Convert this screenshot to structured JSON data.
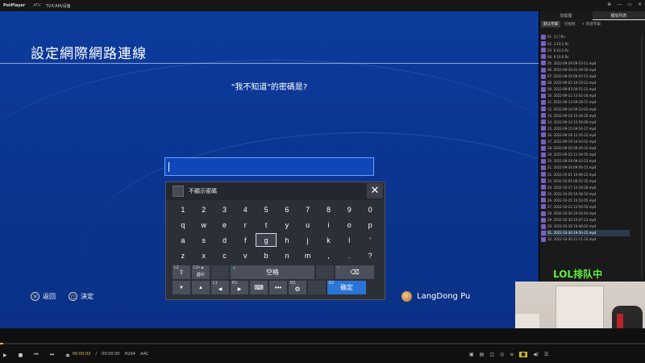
{
  "titlebar": {
    "app": "PotPlayer",
    "crumbs": [
      "ATV",
      "TV/CAM/设备"
    ],
    "window_buttons": [
      "pin",
      "minimize",
      "restore",
      "close"
    ]
  },
  "ps_screen": {
    "title": "設定網際網路連線",
    "question": "\"我不知道\"的密碼是?",
    "keyboard": {
      "hide_password_label": "不顯示密碼",
      "close_label": "✕",
      "rows": [
        [
          "1",
          "2",
          "3",
          "4",
          "5",
          "6",
          "7",
          "8",
          "9",
          "0"
        ],
        [
          "q",
          "w",
          "e",
          "r",
          "t",
          "y",
          "u",
          "i",
          "o",
          "p"
        ],
        [
          "a",
          "s",
          "d",
          "f",
          "g",
          "h",
          "j",
          "k",
          "l",
          "'"
        ],
        [
          "z",
          "x",
          "c",
          "v",
          "b",
          "n",
          "m",
          ",",
          ".",
          "?"
        ]
      ],
      "selected_key": "g",
      "func_row1": {
        "l2_tag": "L2",
        "l2up_tag": "L2+▲",
        "l2up_label": "@#:",
        "tri_tag": "▲",
        "space_label": "空格",
        "square_tag": "□",
        "backspace_label": "⌫"
      },
      "func_row2": {
        "down": "▼",
        "up": "▲",
        "l1_tag": "L1",
        "left": "◀",
        "r1_tag": "R1",
        "right": "▶",
        "keyboard_icon": "⌨",
        "more_label": "•••",
        "r3_tag": "R3",
        "r2_tag": "R2",
        "confirm_label": "确定"
      }
    },
    "footer": {
      "back_symbol": "✕",
      "back_label": "返回",
      "ok_symbol": "○",
      "ok_label": "決定"
    },
    "user": "LangDong Pu"
  },
  "player": {
    "time_current": "00:00:03",
    "time_total": "00:00:00",
    "codec1": "H264",
    "codec2": "AAC",
    "progress_fraction": 0.005,
    "accent": "#e0b83a"
  },
  "panel": {
    "tabs": [
      "加载器",
      "播放列表"
    ],
    "active_tab": 1,
    "subtabs": [
      "默认专辑",
      "近视频",
      "+ 新建专辑"
    ],
    "items": [
      "01. 大门.flv",
      "02. 3.10.1.flv",
      "03. 9.10.2.flv",
      "04. 9.10.6.flv",
      "05. 2022-09-29 09-53-11.mp4",
      "06. 2022-09-30 01-49-50.mp4",
      "07. 2022-09-30 09-47-11.mp4",
      "08. 2022-09-02 10-19-12.mp4",
      "09. 2022-09-03 09-51-21.mp4",
      "10. 2022-09-12 11-02-18.mp4",
      "11. 2022-09-13 09-28-57.mp4",
      "12. 2022-09-14 09-33-03.mp4",
      "13. 2022-09-14 15-34-20.mp4",
      "14. 2022-09-14 15-59-09.mp4",
      "15. 2022-09-15 09-54-17.mp4",
      "16. 2022-09-18 12-16-22.mp4",
      "17. 2022-09-19 10-43-02.mp4",
      "18. 2022-09-20 09-39-31.mp4",
      "19. 2022-09-22 11-34-55.mp4",
      "20. 2022-09-29 09-43-23.mp4",
      "21. 2022-09-30 09-56-15.mp4",
      "22. 2022-10-01 10-08-12.mp4",
      "23. 2022-10-05 09-55-35.mp4",
      "24. 2022-10-17 12-18-28.mp4",
      "25. 2022-10-20 10-38-10.mp4",
      "26. 2022-10-21 10-52-05.mp4",
      "27. 2022-10-22 12-59-55.mp4",
      "28. 2022-10-30 10-43-44.mp4",
      "29. 2022-10-30 10-47-13.mp4",
      "30. 2022-10-30 19-48-02.mp4",
      "31. 2022-10-30 19-50-15.mp4",
      "32. 2022-10-30 21-11-10.mp4"
    ],
    "highlighted_index": 30
  },
  "overlay_text": "LOL排队中"
}
